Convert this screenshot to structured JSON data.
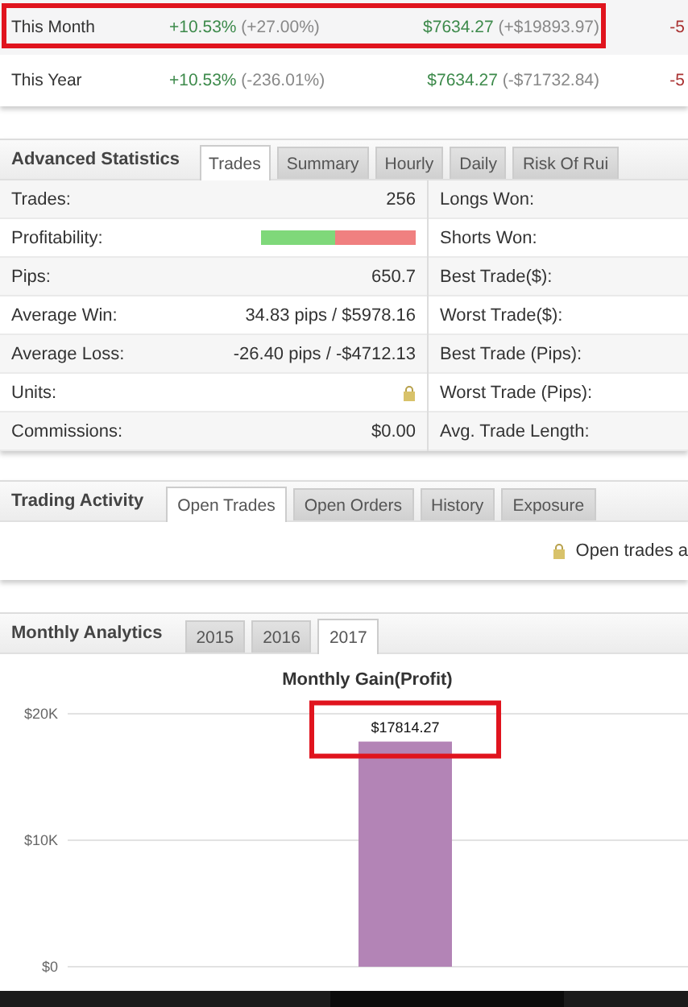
{
  "summary_rows": [
    {
      "label": "This Month",
      "gain": "+10.53%",
      "gain_change": "(+27.00%)",
      "profit": "$7634.27",
      "profit_change": "(+$19893.97)",
      "column_4": "-5",
      "highlighted": true
    },
    {
      "label": "This Year",
      "gain": "+10.53%",
      "gain_change": "(-236.01%)",
      "profit": "$7634.27",
      "profit_change": "(-$71732.84)",
      "column_4": "-5",
      "highlighted": false
    }
  ],
  "advanced_statistics": {
    "title": "Advanced Statistics",
    "tabs": [
      {
        "label": "Trades",
        "selected": true
      },
      {
        "label": "Summary",
        "selected": false
      },
      {
        "label": "Hourly",
        "selected": false
      },
      {
        "label": "Daily",
        "selected": false
      },
      {
        "label": "Risk Of Rui",
        "selected": false
      }
    ],
    "left_rows": [
      {
        "label": "Trades:",
        "kind": "text",
        "value": "256"
      },
      {
        "label": "Profitability:",
        "kind": "bar",
        "level": 0.48
      },
      {
        "label": "Pips:",
        "kind": "text",
        "value": "650.7"
      },
      {
        "label": "Average Win:",
        "kind": "text",
        "value": "34.83 pips / $5978.16"
      },
      {
        "label": "Average Loss:",
        "kind": "text",
        "value": "-26.40 pips / -$4712.13"
      },
      {
        "label": "Units:",
        "kind": "locked"
      },
      {
        "label": "Commissions:",
        "kind": "text",
        "value": "$0.00"
      }
    ],
    "right_rows": [
      "Longs Won:",
      "Shorts Won:",
      "Best Trade($):",
      "Worst Trade($):",
      "Best Trade (Pips):",
      "Worst Trade (Pips):",
      "Avg. Trade Length:"
    ]
  },
  "trading_activity": {
    "title": "Trading Activity",
    "tabs": [
      {
        "label": "Open Trades",
        "selected": true
      },
      {
        "label": "Open Orders",
        "selected": false
      },
      {
        "label": "History",
        "selected": false
      },
      {
        "label": "Exposure",
        "selected": false
      }
    ],
    "notice": "Open trades a"
  },
  "monthly_analytics": {
    "title": "Monthly Analytics",
    "tabs": [
      {
        "label": "2015",
        "selected": false
      },
      {
        "label": "2016",
        "selected": false
      },
      {
        "label": "2017",
        "selected": true
      }
    ],
    "chart_data": {
      "type": "bar",
      "title": "Monthly Gain(Profit)",
      "categories": [
        null
      ],
      "series": [
        {
          "color": "#b384b6",
          "values": [
            17800
          ]
        }
      ],
      "ylim": [
        0,
        20000
      ],
      "yticks": [
        {
          "value": 0,
          "label": "$0"
        },
        {
          "value": 10000,
          "label": "$10K"
        },
        {
          "value": 20000,
          "label": "$20K"
        }
      ],
      "annotations": [
        {
          "text": "$17814.27",
          "y": 17800
        }
      ]
    }
  }
}
